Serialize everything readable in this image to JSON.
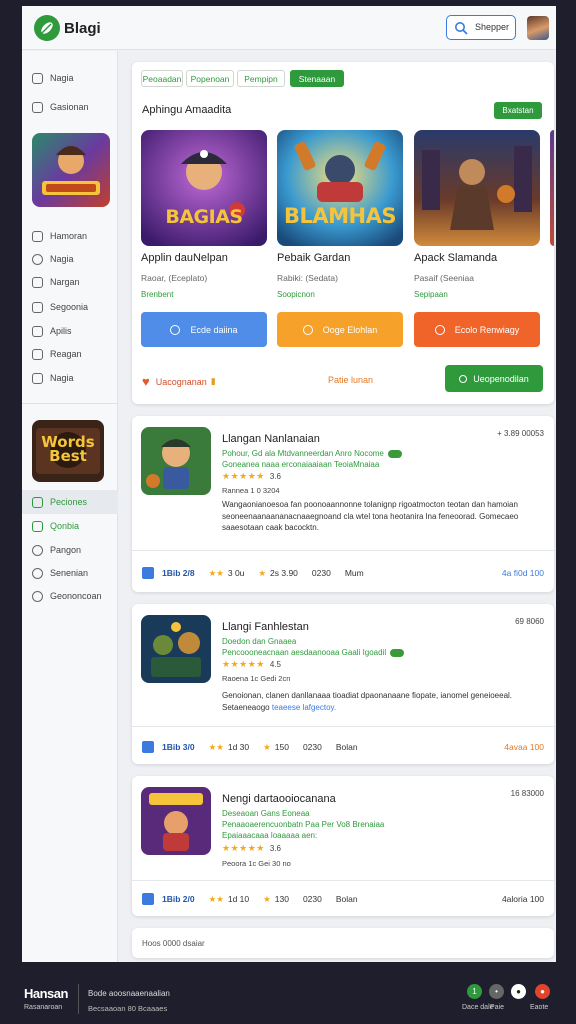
{
  "app": {
    "title": "Blagi"
  },
  "header": {
    "search_label": "Shepper"
  },
  "sidebar": {
    "top_items": [
      {
        "label": "Nagia"
      },
      {
        "label": "Gasionan"
      }
    ],
    "mid_items": [
      {
        "label": "Hamoran"
      },
      {
        "label": "Nagia"
      },
      {
        "label": "Nargan"
      },
      {
        "label": "Segoonia"
      },
      {
        "label": "Apilis"
      },
      {
        "label": "Reagan"
      },
      {
        "label": "Nagia"
      }
    ],
    "bottom_items": [
      {
        "label": "Peciones"
      },
      {
        "label": "Qonbia"
      },
      {
        "label": "Pangon"
      },
      {
        "label": "Senenian"
      },
      {
        "label": "Geononcoan"
      }
    ],
    "thumb2_text": "Words Best"
  },
  "tabs": [
    {
      "label": "Peoaadan"
    },
    {
      "label": "Popenoan"
    },
    {
      "label": "Pempipn"
    },
    {
      "label": "Stenaaan"
    }
  ],
  "featured": {
    "title": "Aphingu Amaadita",
    "button": "Bxatstan",
    "games": [
      {
        "art_text": "BAGIAS",
        "name": "Applin dauNelpan",
        "sub": "Raoar, (Eceplato)",
        "dev": "Brenbent",
        "action": "Ecde daiina",
        "color": "#4f8de8"
      },
      {
        "art_text": "BLAMHAS",
        "name": "Pebaik Gardan",
        "sub": "Rabiki: (Sedata)",
        "dev": "Soopicnon",
        "action": "Ooge Elohlan",
        "color": "#f5a12a"
      },
      {
        "art_text": "",
        "name": "Apack Slamanda",
        "sub": "Pasaif (Seeniaa",
        "dev": "Sepipaan",
        "action": "Ecolo Renwiagy",
        "color": "#f0642a"
      }
    ],
    "favorite_label": "Uacognanan",
    "mid_link": "Patie lunan",
    "download_button": "Ueopenodilan"
  },
  "list": [
    {
      "title": "Llangan Nanlanaian",
      "size": "+ 3.89 00053",
      "green1": "Pohour, Gd ala Mtdvanneerdan Anro Nocome",
      "green2": "Goneanea naaa erconaiaaiaan TeoiaMnaiaa",
      "rating": "3.6",
      "meta": "Rannea 1 0 3204",
      "desc_main": "Wangaonianoesoa fan poonoaannonne tolanignp rigoatmocton teotan dan hamoian seoneenaanaananacnaaegnoand cla wtel tona heotanira lna feneoorad. Gomecaeo saaesotaan caak bacocktn.",
      "desc_link": "",
      "foot_a": "1Bib 2/8",
      "foot_b": "3 0u",
      "foot_c": "2s 3.90",
      "foot_d": "0230",
      "foot_e": "Mum",
      "foot_right": "4a fi0d 100",
      "icon_color": "#3b7be0",
      "right_orange": false
    },
    {
      "title": "Llangi Fanhlestan",
      "size": "69 8060",
      "green1": "Doedon dan Gnaaea",
      "green2": "Pencoooneacnaan aesdaanooaa Gaali Igoadil",
      "rating": "4.5",
      "meta": "Raoena 1c Gedi 2cn",
      "desc_main": "Genoionan, clanen danllanaaa tioadiat dpaonanaane fiopate, ianomel geneioeeal. Setaeneaogo",
      "desc_link": "teaeese lafgectoy.",
      "foot_a": "1Bib 3/0",
      "foot_b": "1d 30",
      "foot_c": "150",
      "foot_d": "0230",
      "foot_e": "Bolan",
      "foot_right": "4avaa 100",
      "icon_color": "#3b7be0",
      "right_orange": true
    },
    {
      "title": "Nengi dartaooiocanana",
      "size": "16 83000",
      "green1": "Deseaoan Gans Eoneaa",
      "green2": "Penaaoaerencuonbatn Paa Per Vo8 Brenaiaa",
      "green3": "Epaiaaacaaa loaaaaa aen:",
      "rating": "3.6",
      "meta": "Peoora 1c Gei 30 no",
      "desc_main": "",
      "desc_link": "",
      "foot_a": "1Bib 2/0",
      "foot_b": "1d 10",
      "foot_c": "130",
      "foot_d": "0230",
      "foot_e": "Bolan",
      "foot_right": "4aloria 100",
      "icon_color": "#3b7be0",
      "right_orange": false
    }
  ],
  "bottom_bar": {
    "text": "Hoos 0000 dsaiar"
  },
  "footer": {
    "logo": "Hansan",
    "logo_sub": "Rasanaroan",
    "text1": "Bode aoosnaaenaalian",
    "text2": "Becsaaoan  80  Bcaaaes",
    "icons": [
      {
        "label": "Dace dale"
      },
      {
        "label": "Paie"
      },
      {
        "label": "Eaote"
      }
    ]
  }
}
